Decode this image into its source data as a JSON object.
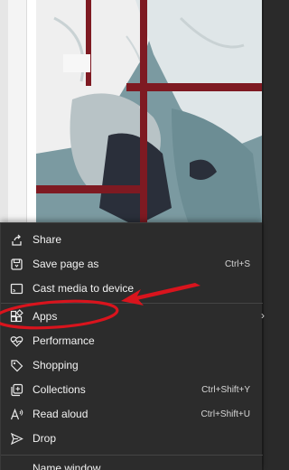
{
  "menu": {
    "items": [
      {
        "label": "Share",
        "icon": "share-icon",
        "shortcut": ""
      },
      {
        "label": "Save page as",
        "icon": "save-page-icon",
        "shortcut": "Ctrl+S"
      },
      {
        "label": "Cast media to device",
        "icon": "cast-icon",
        "shortcut": ""
      },
      {
        "label": "Apps",
        "icon": "apps-icon",
        "shortcut": "",
        "has_submenu": true
      },
      {
        "label": "Performance",
        "icon": "performance-heart-icon",
        "shortcut": ""
      },
      {
        "label": "Shopping",
        "icon": "shopping-tag-icon",
        "shortcut": ""
      },
      {
        "label": "Collections",
        "icon": "collections-icon",
        "shortcut": "Ctrl+Shift+Y"
      },
      {
        "label": "Read aloud",
        "icon": "read-aloud-icon",
        "shortcut": "Ctrl+Shift+U"
      },
      {
        "label": "Drop",
        "icon": "drop-send-icon",
        "shortcut": ""
      },
      {
        "label": "Name window...",
        "icon": "",
        "shortcut": ""
      }
    ]
  },
  "annotation": {
    "color": "#d9141d",
    "highlighted_item": "Apps"
  },
  "colors": {
    "menu_bg": "#2c2c2c",
    "menu_text": "#f2f2f2",
    "separator": "#454545"
  }
}
